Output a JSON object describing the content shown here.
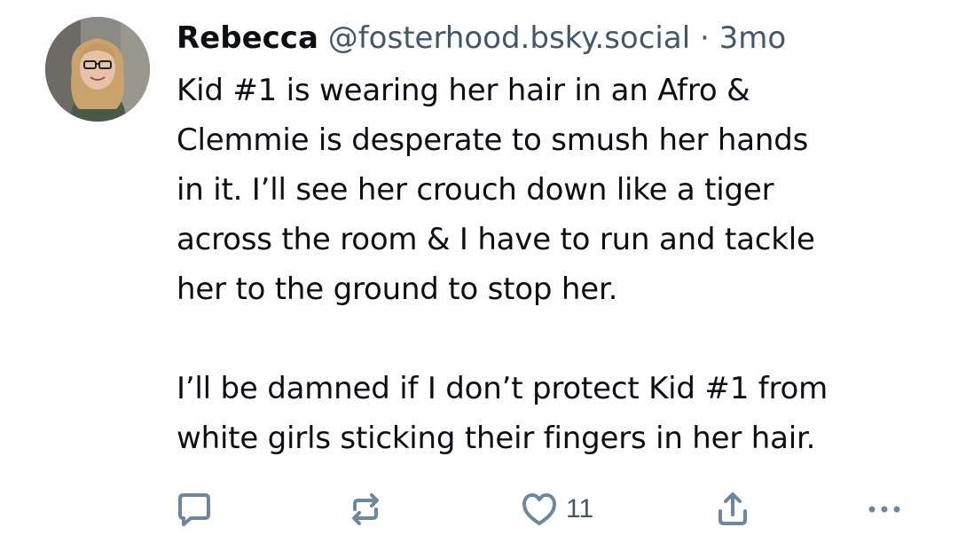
{
  "post": {
    "author": {
      "display_name": "Rebecca",
      "handle": "@fosterhood.bsky.social",
      "separator": "·",
      "time_ago": "3mo"
    },
    "text": "Kid #1 is wearing her hair in an Afro &\nClemmie is desperate to smush her hands\nin it. I’ll see her crouch down like a tiger\nacross the room & I have to run and tackle\nher to the ground to stop her.\n\nI’ll be damned if I don’t protect Kid #1 from\nwhite girls sticking their fingers in her hair.",
    "actions": {
      "reply_icon": "reply-icon",
      "repost_icon": "repost-icon",
      "like_icon": "heart-icon",
      "like_count": "11",
      "share_icon": "share-icon",
      "more_icon": "more-options-icon"
    }
  },
  "colors": {
    "text": "#0b0f14",
    "muted": "#42576c",
    "icon": "#6f869f",
    "background": "#ffffff"
  }
}
